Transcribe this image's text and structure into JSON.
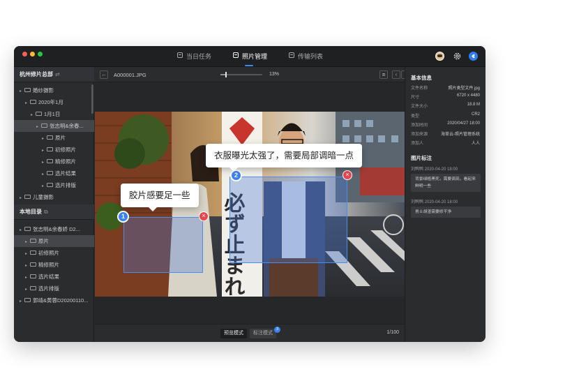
{
  "tabs": [
    {
      "label": "当日任务",
      "icon": "task-icon"
    },
    {
      "label": "照片管理",
      "icon": "photo-manage-icon"
    },
    {
      "label": "传输列表",
      "icon": "transfer-icon"
    }
  ],
  "active_tab": "照片管理",
  "sidebar": {
    "cloud_header": "杭州修片总部",
    "cloud_tree": [
      {
        "label": "婚纱摄影",
        "depth": 0
      },
      {
        "label": "2020年1月",
        "depth": 1
      },
      {
        "label": "1月1日",
        "depth": 2
      },
      {
        "label": "张志明&余春...",
        "depth": 3,
        "selected": true
      },
      {
        "label": "原片",
        "depth": 4
      },
      {
        "label": "初修照片",
        "depth": 4
      },
      {
        "label": "精修照片",
        "depth": 4
      },
      {
        "label": "选片结果",
        "depth": 4
      },
      {
        "label": "选片排版",
        "depth": 4
      },
      {
        "label": "儿童摄影",
        "depth": 0
      }
    ],
    "local_header": "本地目录",
    "local_tree": [
      {
        "label": "张志明&余春娇 D2...",
        "depth": 0
      },
      {
        "label": "原片",
        "depth": 1,
        "selected": true
      },
      {
        "label": "初修照片",
        "depth": 1
      },
      {
        "label": "精修照片",
        "depth": 1
      },
      {
        "label": "选片结果",
        "depth": 1
      },
      {
        "label": "选片排版",
        "depth": 1
      },
      {
        "label": "郭靖&黄蓉D20200110...",
        "depth": 0
      }
    ]
  },
  "toolbar": {
    "filename": "A000001.JPG",
    "zoom": "13%",
    "zoom_fraction": 0.13
  },
  "annotations": [
    {
      "number": "1",
      "comment": "胶片感要足一些"
    },
    {
      "number": "2",
      "comment": "衣服曝光太强了，需要局部调暗一点"
    }
  ],
  "photo_sign_text": "必ず止まれ",
  "bottom": {
    "preview_mode": "预览模式",
    "annotate_mode": "标注模式",
    "annotate_badge": "3",
    "page": "1/100"
  },
  "right_panel": {
    "basic_title": "基本信息",
    "props": [
      {
        "key": "文件名称",
        "value": "照片类型文件.jpg"
      },
      {
        "key": "尺寸",
        "value": "6720 x 4480"
      },
      {
        "key": "文件大小",
        "value": "18.8 M"
      },
      {
        "key": "类型",
        "value": "CR2"
      },
      {
        "key": "添加时间",
        "value": "2020/04/27 18:00"
      },
      {
        "key": "添加来源",
        "value": "海草云-照片管理系统"
      },
      {
        "key": "添加人",
        "value": "人人"
      }
    ],
    "notes_title": "图片标注",
    "notes": [
      {
        "meta": "刘鸭鸭 2020-04-20 18:00",
        "text": "背景绿植黑死，需要调亮，看起来鲜明一些"
      },
      {
        "meta": "刘鸭鸭 2020-04-20 18:00",
        "text": "男士胡渣需要修干净"
      }
    ]
  },
  "colors": {
    "accent": "#3b82f0",
    "close": "#e5484d",
    "window_bg": "#2b2c2e"
  }
}
